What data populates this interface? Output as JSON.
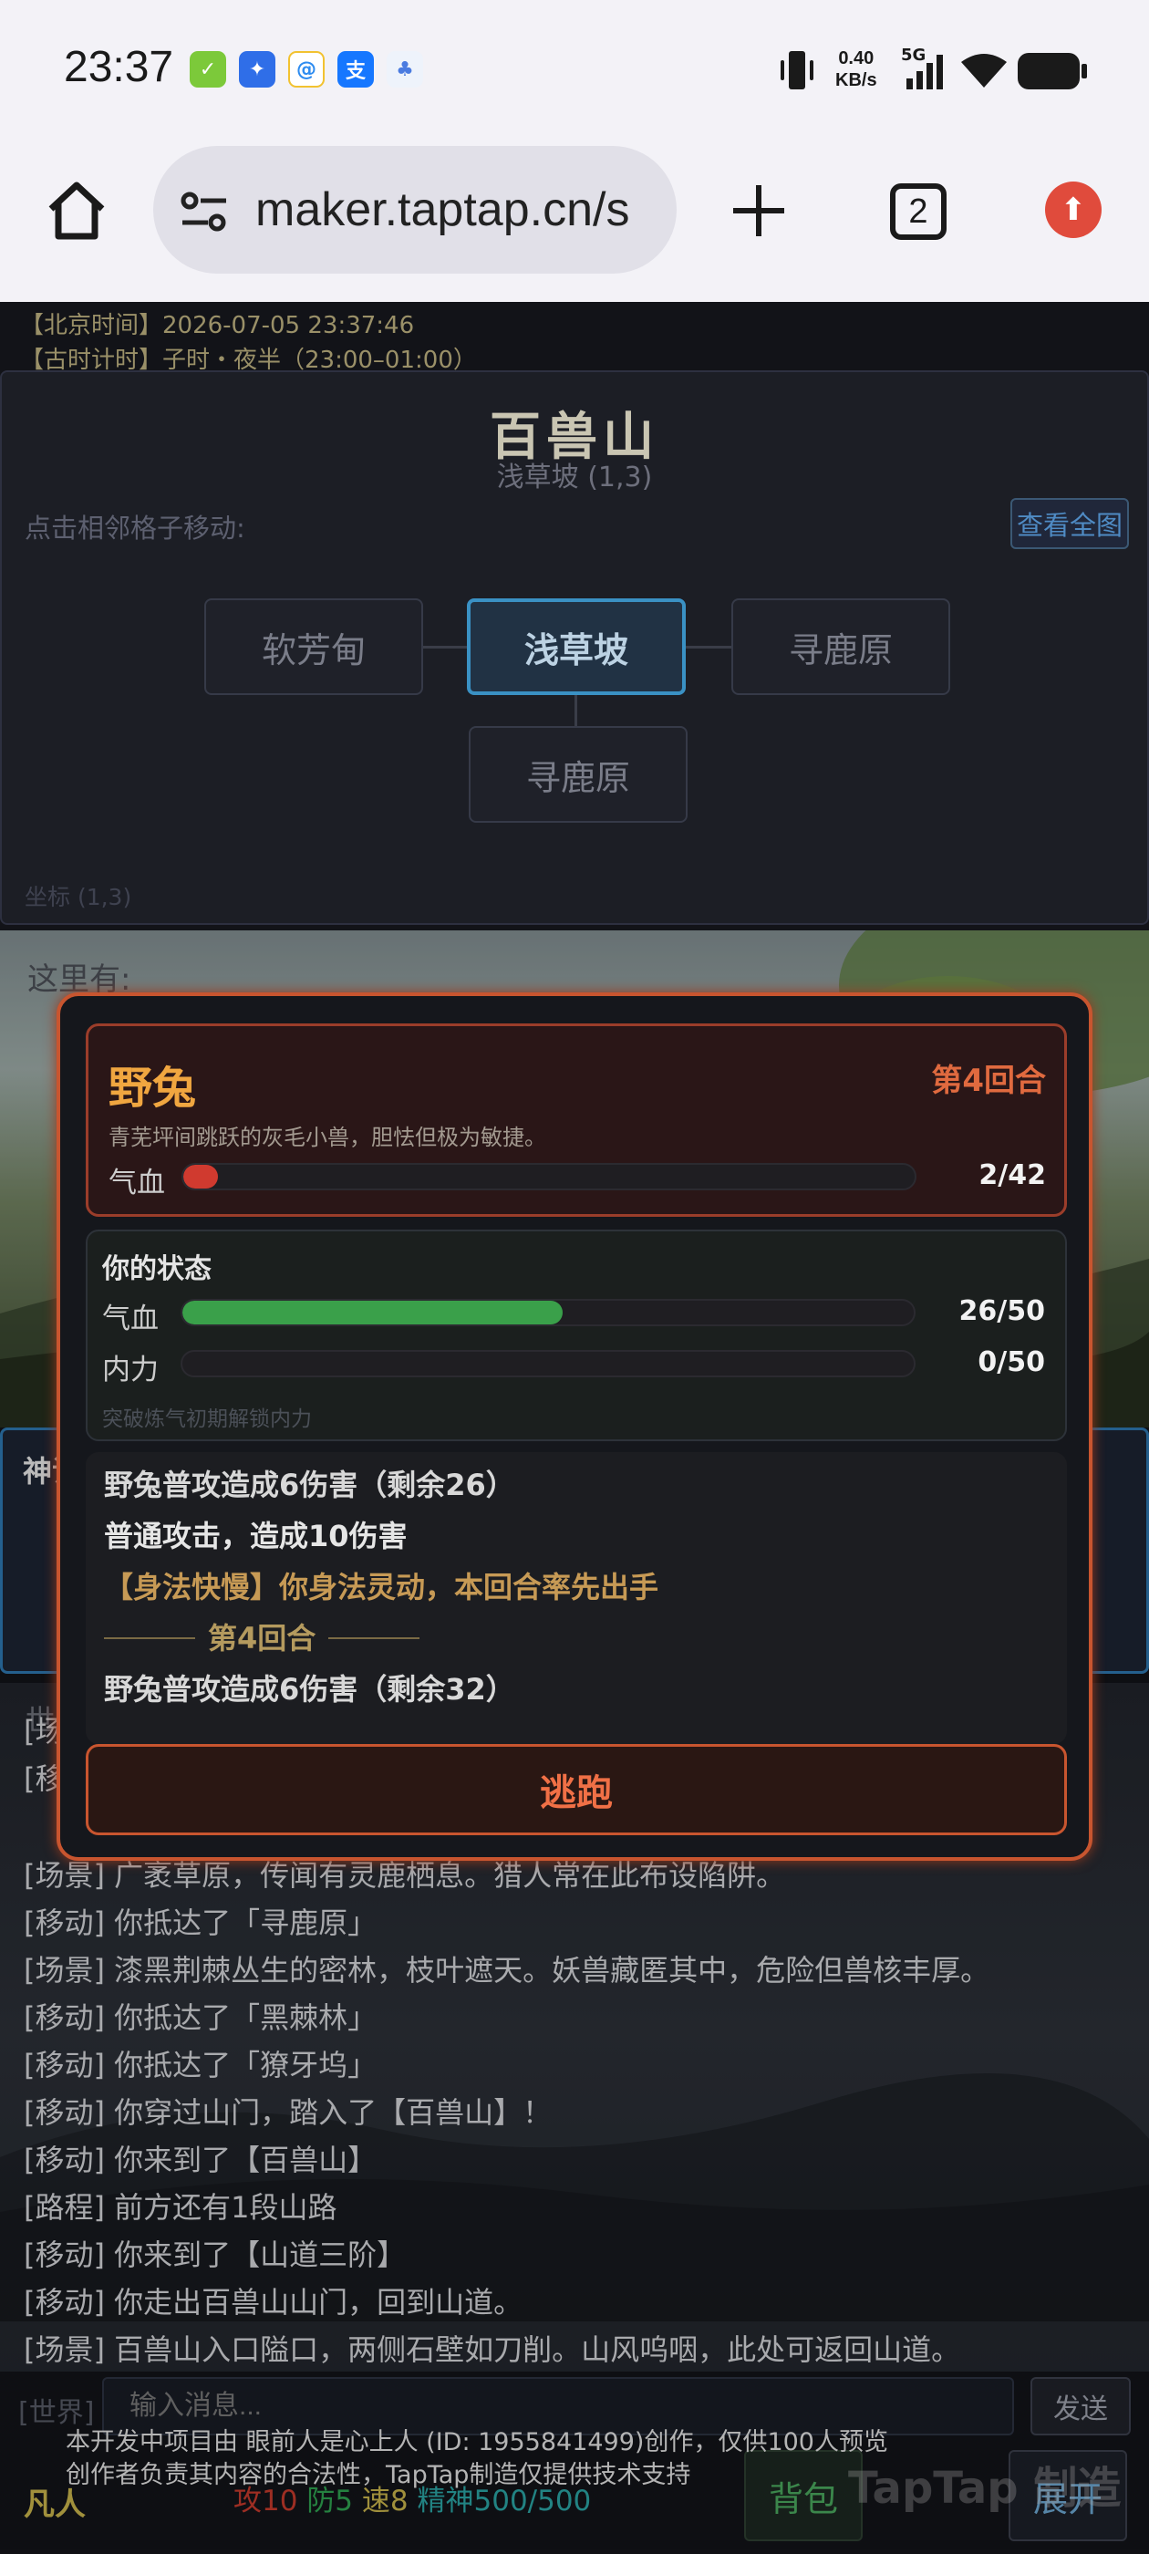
{
  "statusbar": {
    "time": "23:37",
    "net_speed_value": "0.40",
    "net_speed_unit": "KB/s",
    "signal_label": "5G",
    "apps": [
      "wechat-app-icon",
      "app-store-icon",
      "qq-browser-icon",
      "alipay-icon",
      "baidu-netdisk-icon"
    ],
    "icons": [
      "vibrate-icon",
      "signal-bars-icon",
      "wifi-icon",
      "battery-icon"
    ]
  },
  "browser": {
    "url": "maker.taptap.cn/s",
    "tab_count": "2",
    "accent": "#e04b3c"
  },
  "info": {
    "beijing_time": "【北京时间】2026-07-05 23:37:46",
    "ancient_time": "【古时计时】子时・夜半（23:00–01:00）"
  },
  "map": {
    "title": "百兽山",
    "subtitle": "浅草坡 (1,3)",
    "hint": "点击相邻格子移动:",
    "fullmap_button": "查看全图",
    "nodes": {
      "left": "软芳甸",
      "center": "浅草坡",
      "right": "寻鹿原",
      "bottom": "寻鹿原"
    },
    "coordinate": "坐标 (1,3)"
  },
  "scene": {
    "here_label": "这里有:"
  },
  "shenshi": {
    "label": "神识"
  },
  "log": {
    "tab": "世界",
    "lines": [
      "[场景] 广袤草原，传闻有灵鹿栖息。猎人常在此布设陷阱。",
      "[移动] 你抵达了「寻鹿原」",
      "[场景] 漆黑荆棘丛生的密林，枝叶遮天。妖兽藏匿其中，危险但兽核丰厚。",
      "[移动] 你抵达了「黑棘林」",
      "[移动] 你抵达了「獠牙坞」",
      "[移动] 你穿过山门，踏入了【百兽山】！",
      "[移动] 你来到了【百兽山】",
      "[路程] 前方还有1段山路",
      "[移动] 你来到了【山道三阶】",
      "[移动] 你走出百兽山山门，回到山道。",
      "[场景] 百兽山入口隘口，两侧石壁如刀削。山风呜咽，此处可返回山道。"
    ],
    "hidden_prefix_1": "[场",
    "hidden_prefix_2": "[移"
  },
  "chat": {
    "channel": "[世界]",
    "placeholder": "输入消息...",
    "send": "发送"
  },
  "footer": {
    "realm": "凡人",
    "attack": "攻10",
    "defense": "防5",
    "speed": "速8",
    "spirit": "精神500/500",
    "bag_button": "背包",
    "expand_button": "展开",
    "colors": {
      "attack": "#c0392b",
      "defense": "#2e9e4f",
      "speed": "#c4b04a",
      "spirit": "#2aa0a0"
    }
  },
  "watermark": {
    "line1": "本开发中项目由 眼前人是心上人 (ID: 1955841499)创作，仅供100人预览",
    "line2": "创作者负责其内容的合法性，TapTap制造仅提供技术支持",
    "brand": "TapTap 制造"
  },
  "battle": {
    "enemy": {
      "name": "野兔",
      "round": "第4回合",
      "desc": "青芜坪间跳跃的灰毛小兽，胆怯但极为敏捷。",
      "hp_label": "气血",
      "hp_value": "2/42",
      "hp_fraction": 0.048,
      "hp_color": "#d03a2f"
    },
    "self": {
      "title": "你的状态",
      "hp_label": "气血",
      "hp_value": "26/50",
      "hp_fraction": 0.52,
      "hp_color": "#3aa04a",
      "mp_label": "内力",
      "mp_value": "0/50",
      "mp_fraction": 0,
      "mp_hint": "突破炼气初期解锁内力"
    },
    "log": [
      {
        "text": "野兔普攻造成6伤害（剩余26）",
        "color": "#d8d8d8"
      },
      {
        "text": "普通攻击，造成10伤害",
        "color": "#e6e6e6"
      },
      {
        "text": "【身法快慢】你身法灵动，本回合率先出手",
        "color": "#c79a55"
      },
      {
        "text": "第4回合",
        "color": "#b49a5e"
      },
      {
        "text": "野兔普攻造成6伤害（剩余32）",
        "color": "#d8d8d8"
      }
    ],
    "flee_button": "逃跑"
  }
}
